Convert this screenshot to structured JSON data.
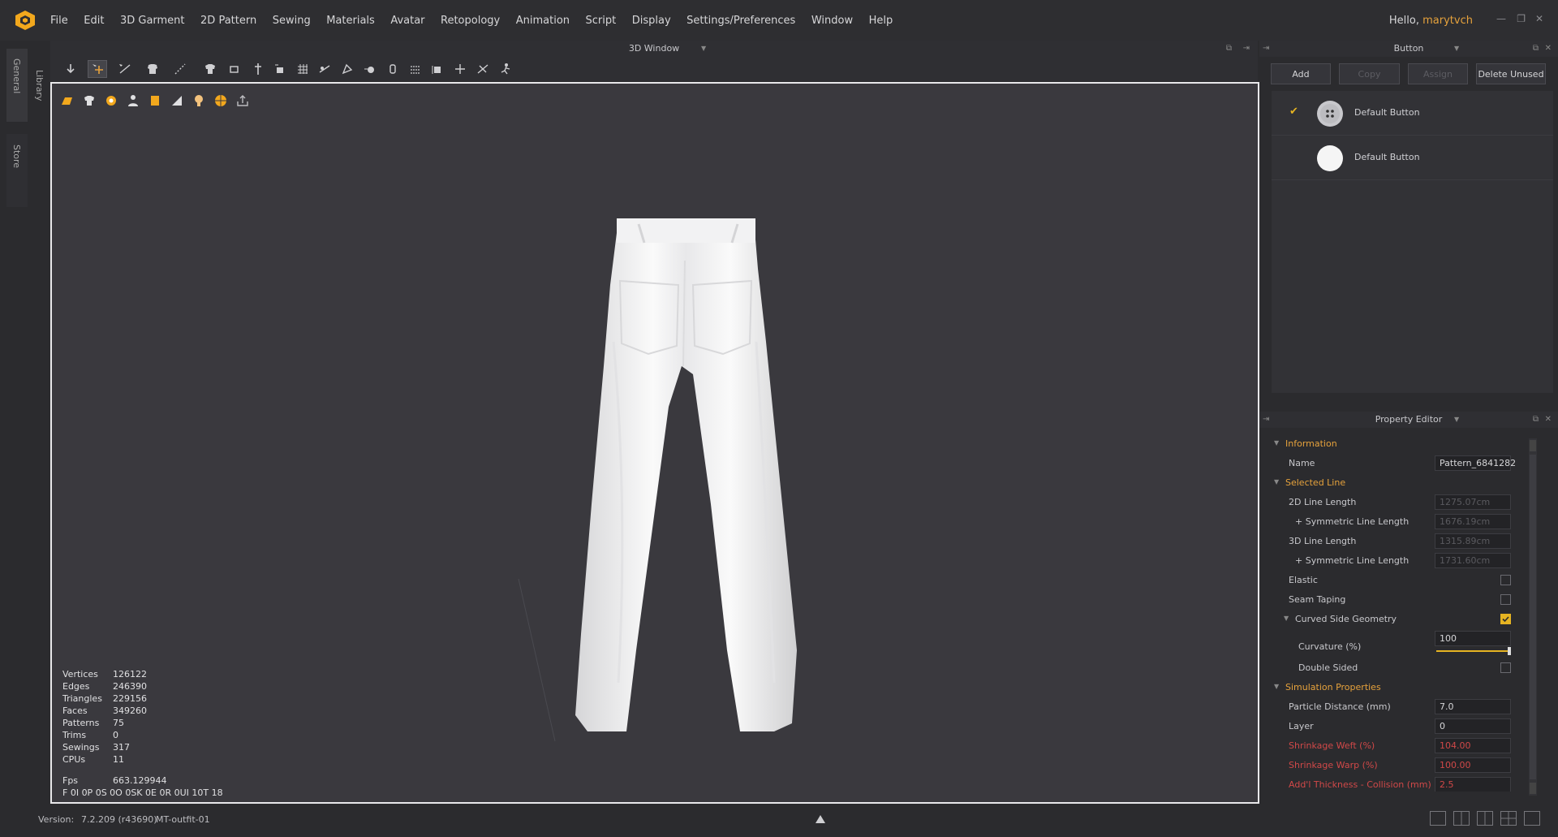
{
  "menubar": {
    "items": [
      "File",
      "Edit",
      "3D Garment",
      "2D Pattern",
      "Sewing",
      "Materials",
      "Avatar",
      "Retopology",
      "Animation",
      "Script",
      "Display",
      "Settings/Preferences",
      "Window",
      "Help"
    ],
    "greeting": "Hello,",
    "username": "marytvch"
  },
  "sidetabs": {
    "general": "General",
    "library": "Library",
    "store": "Store"
  },
  "viewport": {
    "title": "3D Window",
    "stats": [
      {
        "label": "Vertices",
        "value": "126122"
      },
      {
        "label": "Edges",
        "value": "246390"
      },
      {
        "label": "Triangles",
        "value": "229156"
      },
      {
        "label": "Faces",
        "value": "349260"
      },
      {
        "label": "Patterns",
        "value": "75"
      },
      {
        "label": "Trims",
        "value": "0"
      },
      {
        "label": "Sewings",
        "value": "317"
      },
      {
        "label": "CPUs",
        "value": "11"
      }
    ],
    "fps_label": "Fps",
    "fps_value": "663.129944",
    "debug_line": "F 0I 0P 0S 0O 0SK 0E 0R 0UI 10T 18"
  },
  "button_panel": {
    "title": "Button",
    "add": "Add",
    "copy": "Copy",
    "assign": "Assign",
    "delete_unused": "Delete Unused",
    "items": [
      {
        "label": "Default Button",
        "selected": true
      },
      {
        "label": "Default Button",
        "selected": false
      }
    ]
  },
  "property_editor": {
    "title": "Property Editor",
    "information": "Information",
    "name_label": "Name",
    "name_value": "Pattern_6841282",
    "selected_line": "Selected Line",
    "line2d_label": "2D Line Length",
    "line2d_value": "1275.07cm",
    "sym1_label": "+ Symmetric Line Length",
    "sym1_value": "1676.19cm",
    "line3d_label": "3D Line Length",
    "line3d_value": "1315.89cm",
    "sym2_label": "+ Symmetric Line Length",
    "sym2_value": "1731.60cm",
    "elastic": "Elastic",
    "seam_taping": "Seam Taping",
    "curved_side": "Curved Side Geometry",
    "curvature_label": "Curvature (%)",
    "curvature_value": "100",
    "curvature_level": 1.0,
    "double_sided": "Double Sided",
    "simulation": "Simulation Properties",
    "particle_label": "Particle Distance (mm)",
    "particle_value": "7.0",
    "layer_label": "Layer",
    "layer_value": "0",
    "weft_label": "Shrinkage Weft (%)",
    "weft_value": "104.00",
    "warp_label": "Shrinkage Warp (%)",
    "warp_value": "100.00",
    "thickness_label": "Add'l Thickness - Collision (mm)",
    "thickness_value": "2.5"
  },
  "status": {
    "version_label": "Version:",
    "version_value": "7.2.209 (r43690)",
    "project": "MT-outfit-01"
  },
  "colors": {
    "accent": "#e6a23c",
    "warning": "#d04848",
    "background": "#2b2b2e",
    "viewport": "#3a393e"
  }
}
